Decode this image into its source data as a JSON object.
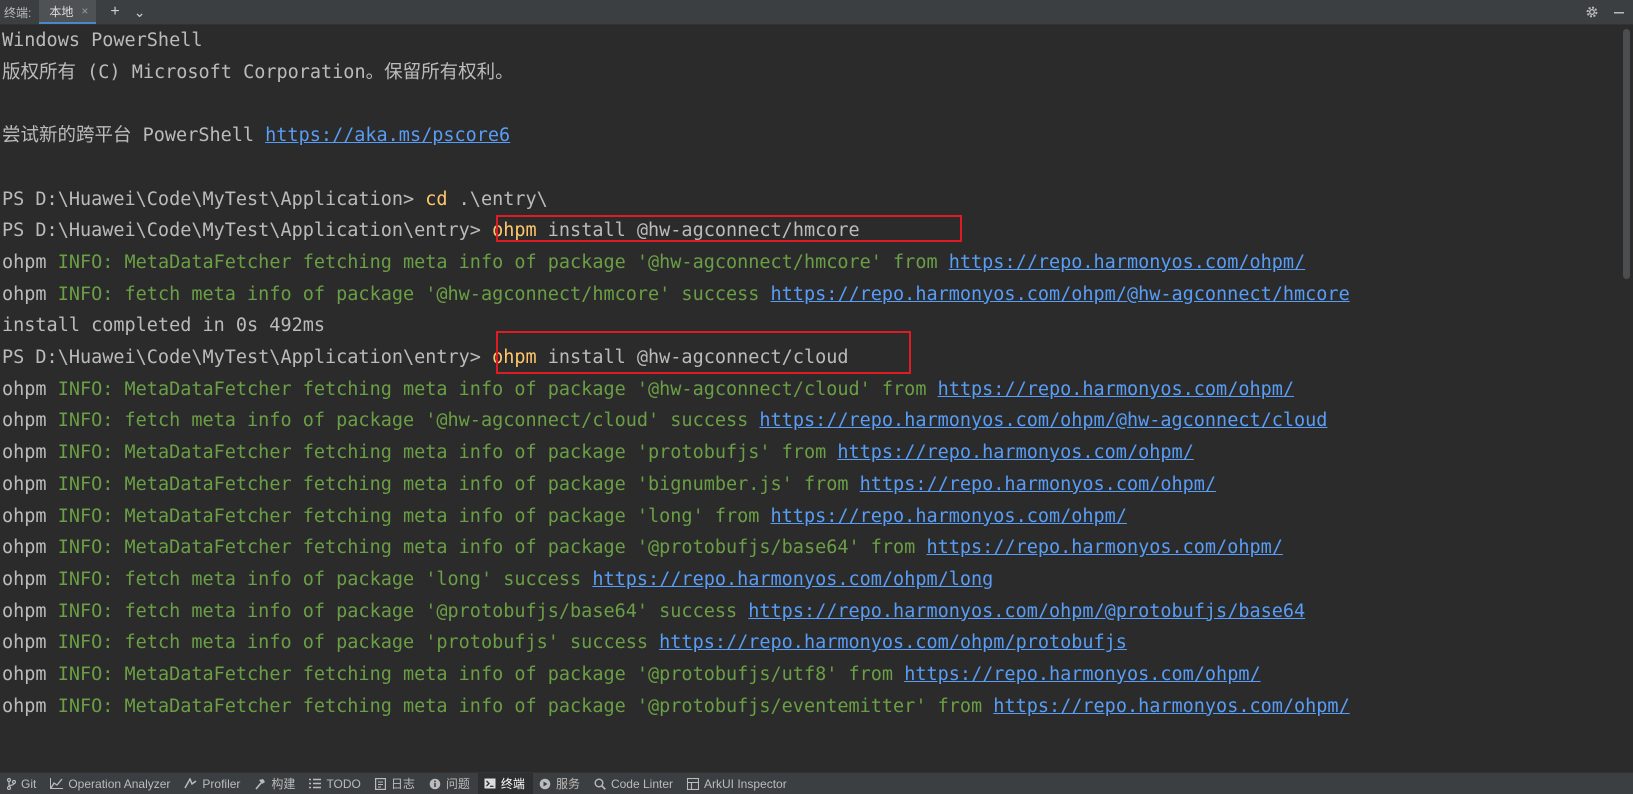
{
  "tabbar": {
    "label": "终端:",
    "tab": "本地",
    "close": "×",
    "add": "+",
    "dropdown": "⌄"
  },
  "terminal": {
    "lines": [
      [
        {
          "t": "Windows PowerShell",
          "c": "plain"
        }
      ],
      [
        {
          "t": "版权所有 (C) Microsoft Corporation。保留所有权利。",
          "c": "plain"
        }
      ],
      [],
      [
        {
          "t": "尝试新的跨平台 PowerShell ",
          "c": "plain"
        },
        {
          "t": "https://aka.ms/pscore6",
          "c": "url"
        }
      ],
      [],
      [
        {
          "t": "PS D:\\Huawei\\Code\\MyTest\\Application> ",
          "c": "plain"
        },
        {
          "t": "cd",
          "c": "kw"
        },
        {
          "t": " .\\entry\\",
          "c": "plain"
        }
      ],
      [
        {
          "t": "PS D:\\Huawei\\Code\\MyTest\\Application\\entry> ",
          "c": "plain"
        },
        {
          "t": "ohpm",
          "c": "kw"
        },
        {
          "t": " install @hw-agconnect/hmcore",
          "c": "plain"
        }
      ],
      [
        {
          "t": "ohpm ",
          "c": "plain"
        },
        {
          "t": "INFO: MetaDataFetcher fetching meta info of package '@hw-agconnect/hmcore' from ",
          "c": "info"
        },
        {
          "t": "https://repo.harmonyos.com/ohpm/",
          "c": "url"
        }
      ],
      [
        {
          "t": "ohpm ",
          "c": "plain"
        },
        {
          "t": "INFO: fetch meta info of package '@hw-agconnect/hmcore' success ",
          "c": "info"
        },
        {
          "t": "https://repo.harmonyos.com/ohpm/@hw-agconnect/hmcore",
          "c": "url"
        }
      ],
      [
        {
          "t": "install completed in 0s 492ms",
          "c": "plain"
        }
      ],
      [
        {
          "t": "PS D:\\Huawei\\Code\\MyTest\\Application\\entry> ",
          "c": "plain"
        },
        {
          "t": "ohpm",
          "c": "kw"
        },
        {
          "t": " install @hw-agconnect/cloud",
          "c": "plain"
        }
      ],
      [
        {
          "t": "ohpm ",
          "c": "plain"
        },
        {
          "t": "INFO: MetaDataFetcher fetching meta info of package '@hw-agconnect/cloud' from ",
          "c": "info"
        },
        {
          "t": "https://repo.harmonyos.com/ohpm/",
          "c": "url"
        }
      ],
      [
        {
          "t": "ohpm ",
          "c": "plain"
        },
        {
          "t": "INFO: fetch meta info of package '@hw-agconnect/cloud' success ",
          "c": "info"
        },
        {
          "t": "https://repo.harmonyos.com/ohpm/@hw-agconnect/cloud",
          "c": "url"
        }
      ],
      [
        {
          "t": "ohpm ",
          "c": "plain"
        },
        {
          "t": "INFO: MetaDataFetcher fetching meta info of package 'protobufjs' from ",
          "c": "info"
        },
        {
          "t": "https://repo.harmonyos.com/ohpm/",
          "c": "url"
        }
      ],
      [
        {
          "t": "ohpm ",
          "c": "plain"
        },
        {
          "t": "INFO: MetaDataFetcher fetching meta info of package 'bignumber.js' from ",
          "c": "info"
        },
        {
          "t": "https://repo.harmonyos.com/ohpm/",
          "c": "url"
        }
      ],
      [
        {
          "t": "ohpm ",
          "c": "plain"
        },
        {
          "t": "INFO: MetaDataFetcher fetching meta info of package 'long' from ",
          "c": "info"
        },
        {
          "t": "https://repo.harmonyos.com/ohpm/",
          "c": "url"
        }
      ],
      [
        {
          "t": "ohpm ",
          "c": "plain"
        },
        {
          "t": "INFO: MetaDataFetcher fetching meta info of package '@protobufjs/base64' from ",
          "c": "info"
        },
        {
          "t": "https://repo.harmonyos.com/ohpm/",
          "c": "url"
        }
      ],
      [
        {
          "t": "ohpm ",
          "c": "plain"
        },
        {
          "t": "INFO: fetch meta info of package 'long' success ",
          "c": "info"
        },
        {
          "t": "https://repo.harmonyos.com/ohpm/long",
          "c": "url"
        }
      ],
      [
        {
          "t": "ohpm ",
          "c": "plain"
        },
        {
          "t": "INFO: fetch meta info of package '@protobufjs/base64' success ",
          "c": "info"
        },
        {
          "t": "https://repo.harmonyos.com/ohpm/@protobufjs/base64",
          "c": "url"
        }
      ],
      [
        {
          "t": "ohpm ",
          "c": "plain"
        },
        {
          "t": "INFO: fetch meta info of package 'protobufjs' success ",
          "c": "info"
        },
        {
          "t": "https://repo.harmonyos.com/ohpm/protobufjs",
          "c": "url"
        }
      ],
      [
        {
          "t": "ohpm ",
          "c": "plain"
        },
        {
          "t": "INFO: MetaDataFetcher fetching meta info of package '@protobufjs/utf8' from ",
          "c": "info"
        },
        {
          "t": "https://repo.harmonyos.com/ohpm/",
          "c": "url"
        }
      ],
      [
        {
          "t": "ohpm ",
          "c": "plain"
        },
        {
          "t": "INFO: MetaDataFetcher fetching meta info of package '@protobufjs/eventemitter' from ",
          "c": "info"
        },
        {
          "t": "https://repo.harmonyos.com/ohpm/",
          "c": "url"
        }
      ]
    ]
  },
  "statusbar": {
    "items": [
      {
        "label": "Git",
        "icon": "git-branch-icon"
      },
      {
        "label": "Operation Analyzer",
        "icon": "chart-icon"
      },
      {
        "label": "Profiler",
        "icon": "profiler-icon"
      },
      {
        "label": "构建",
        "icon": "hammer-icon"
      },
      {
        "label": "TODO",
        "icon": "list-icon"
      },
      {
        "label": "日志",
        "icon": "log-icon"
      },
      {
        "label": "问题",
        "icon": "info-icon"
      },
      {
        "label": "终端",
        "icon": "terminal-icon"
      },
      {
        "label": "服务",
        "icon": "play-icon"
      },
      {
        "label": "Code Linter",
        "icon": "search-icon"
      },
      {
        "label": "ArkUI Inspector",
        "icon": "grid-icon"
      }
    ],
    "active": "终端"
  },
  "colors": {
    "background": "#2b2b2b",
    "text": "#bbbbbb",
    "keyword": "#ffc66d",
    "info": "#6a9f45",
    "link": "#589df6",
    "highlight_box": "#e01b24"
  }
}
